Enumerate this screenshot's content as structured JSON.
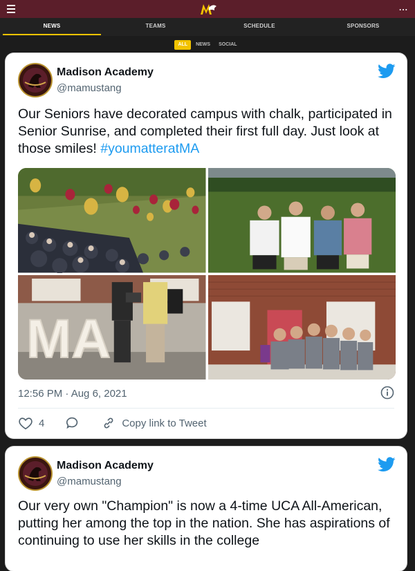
{
  "nav": {
    "tabs": [
      {
        "label": "NEWS",
        "active": true
      },
      {
        "label": "TEAMS",
        "active": false
      },
      {
        "label": "SCHEDULE",
        "active": false
      },
      {
        "label": "SPONSORS",
        "active": false
      }
    ],
    "filters": [
      {
        "label": "ALL",
        "active": true
      },
      {
        "label": "NEWS",
        "active": false
      },
      {
        "label": "SOCIAL",
        "active": false
      }
    ],
    "more_label": "..."
  },
  "colors": {
    "brand": "#5b1e2a",
    "accent": "#f2c300",
    "twitter": "#1d9bf0"
  },
  "tweets": [
    {
      "author": "Madison Academy",
      "handle": "@mamustang",
      "text": "Our Seniors have decorated campus with chalk, participated in Senior Sunrise, and completed their first full day. Just look at those smiles! ",
      "hashtag": "#youmatteratMA",
      "timestamp": "12:56 PM · Aug 6, 2021",
      "likes": "4",
      "copy_link_label": "Copy link to Tweet",
      "photo_marquee_letters": "MA"
    },
    {
      "author": "Madison Academy",
      "handle": "@mamustang",
      "text": "Our very own \"Champion\" is now a 4-time UCA All-American, putting her among the top in the nation. She has aspirations of continuing to use her skills in the college"
    }
  ]
}
